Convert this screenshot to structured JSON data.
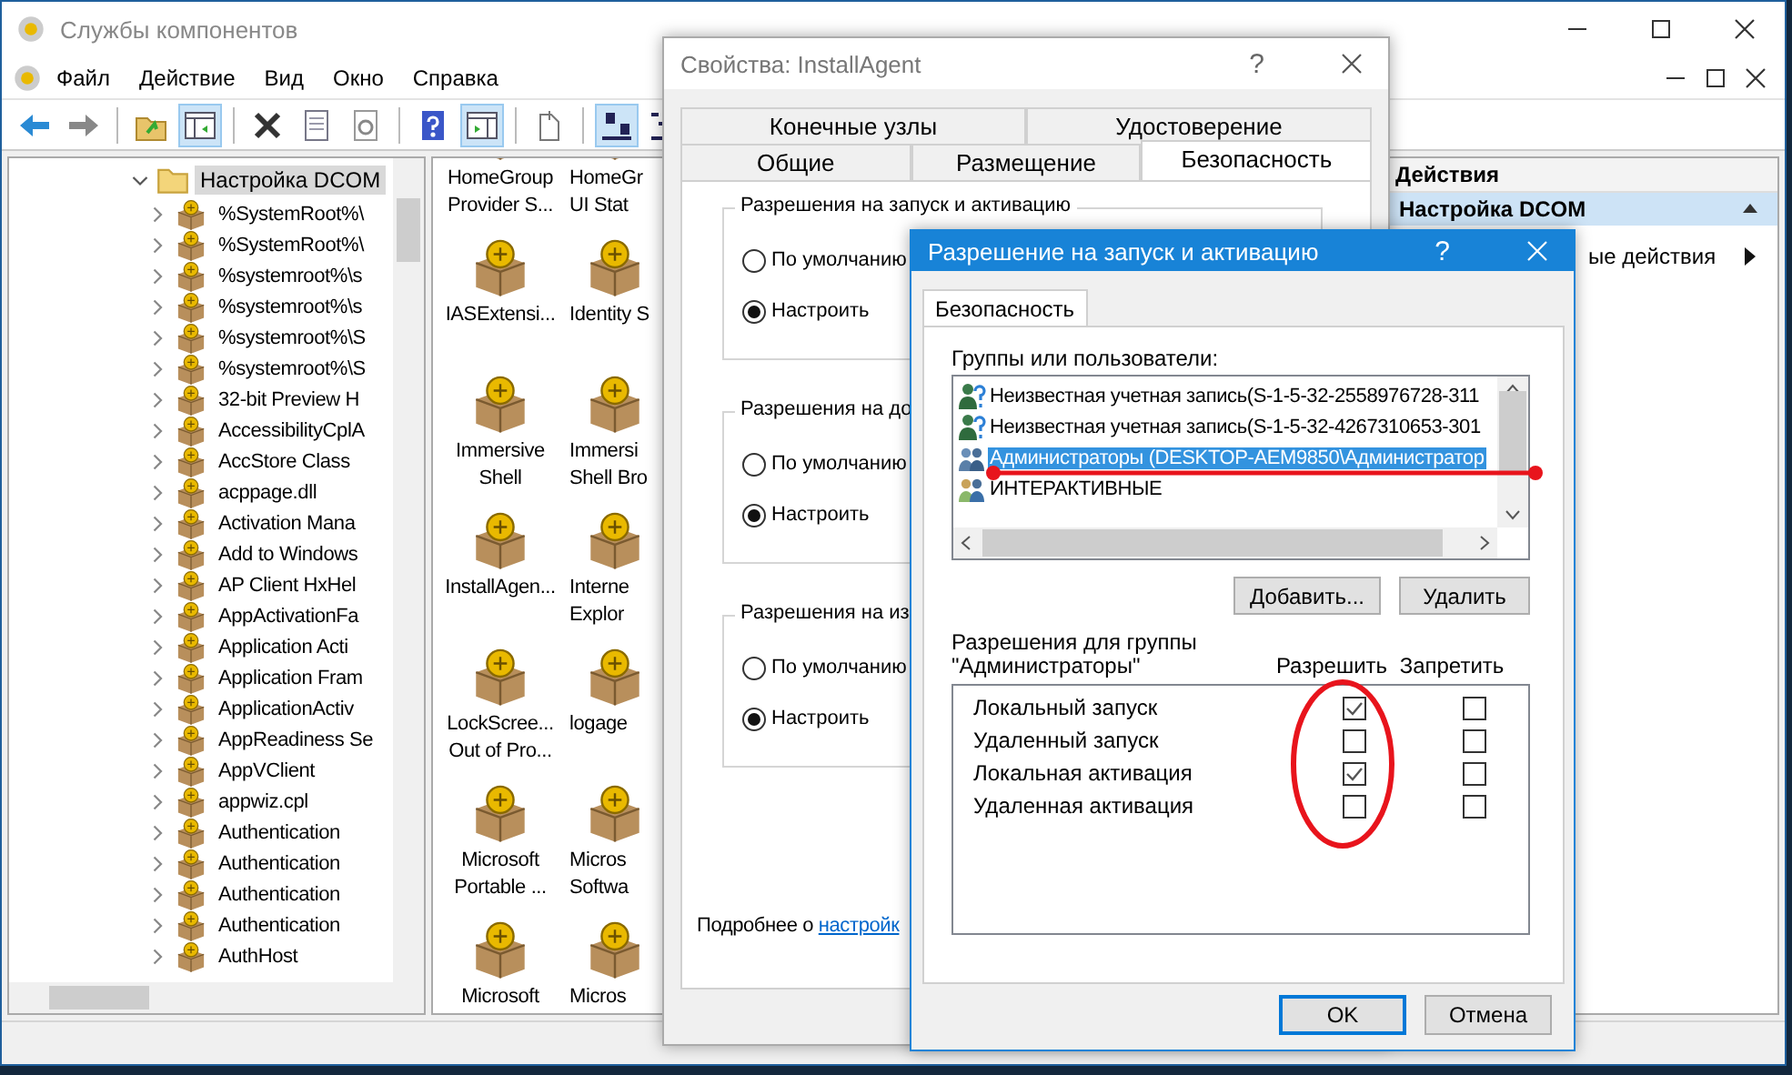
{
  "window": {
    "title": "Службы компонентов"
  },
  "menu": [
    "Файл",
    "Действие",
    "Вид",
    "Окно",
    "Справка"
  ],
  "tree": {
    "label": "Настройка DCOM",
    "expanded": true,
    "selected": true,
    "children": [
      {
        "label": "%SystemRoot%\\",
        "expanded": false
      },
      {
        "label": "%SystemRoot%\\",
        "expanded": false
      },
      {
        "label": "%systemroot%\\s",
        "expanded": false
      },
      {
        "label": "%systemroot%\\s",
        "expanded": false
      },
      {
        "label": "%systemroot%\\S",
        "expanded": false
      },
      {
        "label": "%systemroot%\\S",
        "expanded": false
      },
      {
        "label": "32-bit Preview H",
        "expanded": false
      },
      {
        "label": "AccessibilityCplA",
        "expanded": false
      },
      {
        "label": "AccStore Class",
        "expanded": false
      },
      {
        "label": "acppage.dll",
        "expanded": false
      },
      {
        "label": "Activation Mana",
        "expanded": false
      },
      {
        "label": "Add to Windows",
        "expanded": false
      },
      {
        "label": "AP Client HxHel",
        "expanded": false
      },
      {
        "label": "AppActivationFa",
        "expanded": false
      },
      {
        "label": "Application Acti",
        "expanded": false
      },
      {
        "label": "Application Fram",
        "expanded": false
      },
      {
        "label": "ApplicationActiv",
        "expanded": false
      },
      {
        "label": "AppReadiness Se",
        "expanded": false
      },
      {
        "label": "AppVClient",
        "expanded": false
      },
      {
        "label": "appwiz.cpl",
        "expanded": false
      },
      {
        "label": "Authentication",
        "expanded": false
      },
      {
        "label": "Authentication",
        "expanded": false
      },
      {
        "label": "Authentication",
        "expanded": false
      },
      {
        "label": "Authentication",
        "expanded": false
      },
      {
        "label": "AuthHost",
        "expanded": false
      }
    ]
  },
  "components": [
    {
      "label": "HomeGroup\nProvider S..."
    },
    {
      "label": "HomeGr\nUI Stat"
    },
    {
      "label": "IASExtensi..."
    },
    {
      "label": "Identity S"
    },
    {
      "label": "Immersive\nShell"
    },
    {
      "label": "Immersi\nShell Bro"
    },
    {
      "label": "InstallAgen..."
    },
    {
      "label": "Interne\nExplor"
    },
    {
      "label": "LockScree...\nOut of Pro..."
    },
    {
      "label": "logage"
    },
    {
      "label": "Microsoft\nPortable ..."
    },
    {
      "label": "Micros\nSoftwa"
    },
    {
      "label": "Microsoft"
    },
    {
      "label": "Micros"
    }
  ],
  "actions": {
    "title": "Действия",
    "items": [
      {
        "label": "Настройка DCOM",
        "kind": "header",
        "expanded": true
      },
      {
        "label": "ые действия",
        "kind": "submenu"
      }
    ]
  },
  "properties_dialog": {
    "title": "Свойства: InstallAgent",
    "help": "?",
    "tab_rows": [
      {
        "tabs": [
          {
            "label": "Конечные узлы",
            "selected": false
          },
          {
            "label": "Удостоверение",
            "selected": false
          }
        ]
      },
      {
        "tabs": [
          {
            "label": "Общие",
            "selected": false
          },
          {
            "label": "Размещение",
            "selected": false
          },
          {
            "label": "Безопасность",
            "selected": true
          }
        ]
      }
    ],
    "groups": [
      {
        "title": "Разрешения на запуск и активацию",
        "options": [
          {
            "label": "По умолчанию",
            "selected": false
          },
          {
            "label": "Настроить",
            "selected": true
          }
        ]
      },
      {
        "title": "Разрешения на до",
        "options": [
          {
            "label": "По умолчанию",
            "selected": false
          },
          {
            "label": "Настроить",
            "selected": true
          }
        ]
      },
      {
        "title": "Разрешения на из",
        "options": [
          {
            "label": "По умолчанию",
            "selected": false
          },
          {
            "label": "Настроить",
            "selected": true
          }
        ]
      }
    ],
    "footer": {
      "text": "Подробнее о ",
      "link": "настройк"
    }
  },
  "permission_dialog": {
    "title": "Разрешение на запуск и активацию",
    "help": "?",
    "tabs": [
      {
        "label": "Безопасность",
        "selected": true
      }
    ],
    "principals_label": "Группы или пользователи:",
    "principals": [
      {
        "name": "Неизвестная учетная запись(S-1-5-32-2558976728-311",
        "kind": "unknown",
        "selected": false
      },
      {
        "name": "Неизвестная учетная запись(S-1-5-32-4267310653-301",
        "kind": "unknown",
        "selected": false
      },
      {
        "name": "Администраторы (DESKTOP-AEM9850\\Администратор",
        "kind": "group",
        "selected": true
      },
      {
        "name": "ИНТЕРАКТИВНЫЕ",
        "kind": "special",
        "selected": false
      }
    ],
    "principal_buttons": [
      "Добавить...",
      "Удалить"
    ],
    "permissions_label": "Разрешения для группы\n\"Администраторы\"",
    "columns": [
      "Разрешить",
      "Запретить"
    ],
    "permissions": [
      {
        "name": "Локальный запуск",
        "allow": true,
        "deny": false
      },
      {
        "name": "Удаленный запуск",
        "allow": false,
        "deny": false
      },
      {
        "name": "Локальная активация",
        "allow": true,
        "deny": false
      },
      {
        "name": "Удаленная активация",
        "allow": false,
        "deny": false
      }
    ],
    "buttons": [
      {
        "label": "OK",
        "default": true
      },
      {
        "label": "Отмена",
        "default": false
      }
    ]
  }
}
